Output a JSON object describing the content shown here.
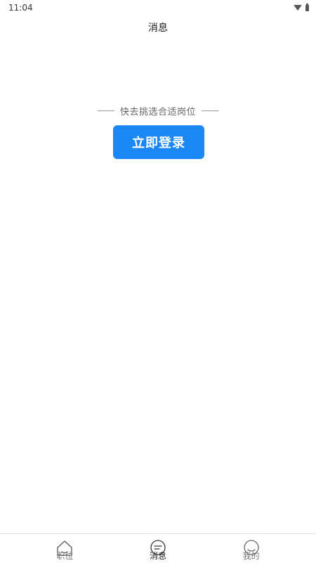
{
  "status_bar": {
    "time": "11:04"
  },
  "header": {
    "title": "消息"
  },
  "empty_state": {
    "prompt": "快去挑选合适岗位",
    "login_button": "立即登录",
    "accent_color": "#1a87f5"
  },
  "tab_bar": {
    "active": "消息",
    "tabs": [
      {
        "label": "职位",
        "icon": "home-icon"
      },
      {
        "label": "消息",
        "icon": "message-icon"
      },
      {
        "label": "我的",
        "icon": "profile-icon"
      }
    ]
  }
}
